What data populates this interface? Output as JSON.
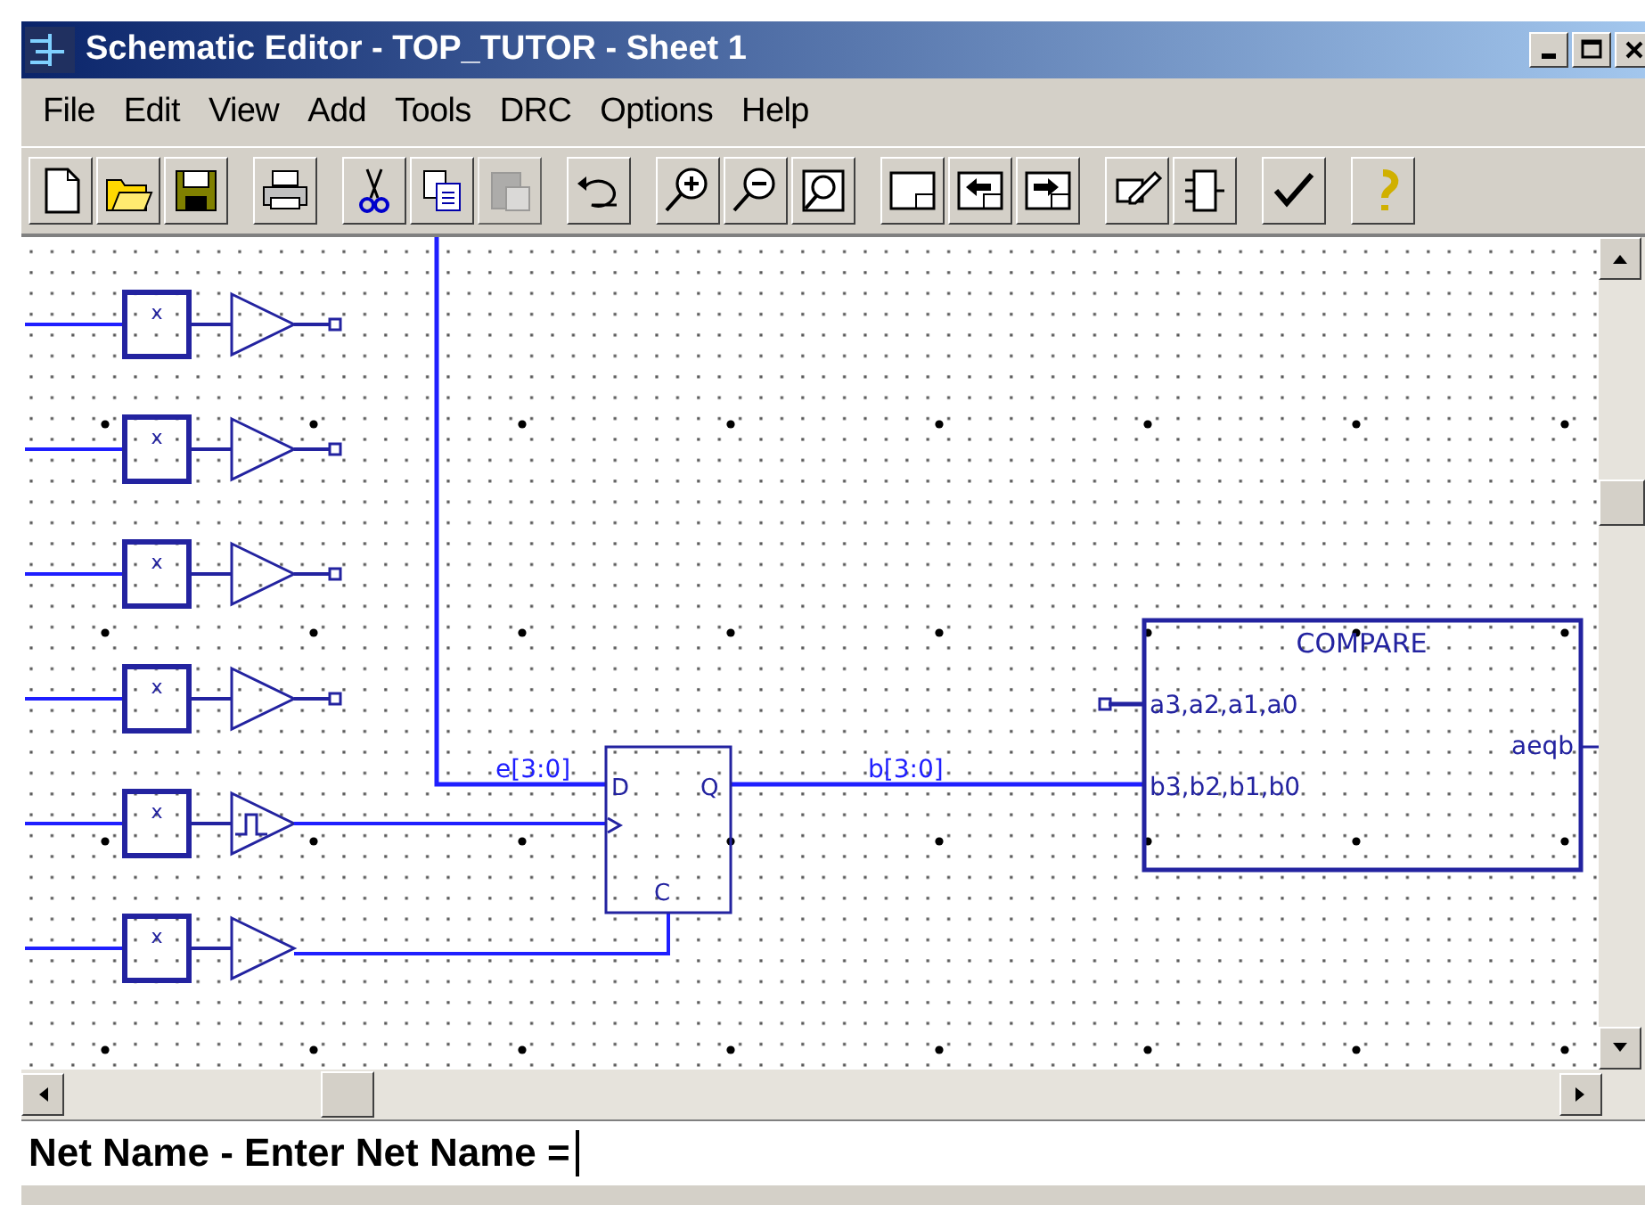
{
  "window": {
    "title": "Schematic Editor - TOP_TUTOR - Sheet 1"
  },
  "menu": [
    "File",
    "Edit",
    "View",
    "Add",
    "Tools",
    "DRC",
    "Options",
    "Help"
  ],
  "toolbar": [
    [
      {
        "kind": "new",
        "disabled": false
      },
      {
        "kind": "open",
        "disabled": false
      },
      {
        "kind": "save",
        "disabled": false
      }
    ],
    [
      {
        "kind": "print",
        "disabled": false
      }
    ],
    [
      {
        "kind": "cut",
        "disabled": false
      },
      {
        "kind": "copy",
        "disabled": false
      },
      {
        "kind": "paste",
        "disabled": true
      }
    ],
    [
      {
        "kind": "undo",
        "disabled": false
      }
    ],
    [
      {
        "kind": "zoom-in",
        "disabled": false
      },
      {
        "kind": "zoom-out",
        "disabled": false
      },
      {
        "kind": "zoom-fit",
        "disabled": false
      }
    ],
    [
      {
        "kind": "sheet",
        "disabled": false
      },
      {
        "kind": "sheet-prev",
        "disabled": false
      },
      {
        "kind": "sheet-next",
        "disabled": false
      }
    ],
    [
      {
        "kind": "edit-symbol",
        "disabled": false
      },
      {
        "kind": "symbol",
        "disabled": false
      }
    ],
    [
      {
        "kind": "check",
        "disabled": false
      }
    ],
    [
      {
        "kind": "help",
        "disabled": false
      }
    ]
  ],
  "schematic": {
    "gates": [
      {
        "kind": "buffer-port",
        "label": "x"
      },
      {
        "kind": "buffer-port",
        "label": "x"
      },
      {
        "kind": "buffer-port",
        "label": "x"
      },
      {
        "kind": "buffer-port",
        "label": "x"
      },
      {
        "kind": "schmitt",
        "label": "x"
      },
      {
        "kind": "buffer",
        "label": "x"
      }
    ],
    "flip_flop": {
      "d": "D",
      "q": "Q",
      "c": "C"
    },
    "nets": [
      "e[3:0]",
      "b[3:0]"
    ],
    "compare": {
      "title": "COMPARE",
      "inputs": [
        "a3,a2,a1,a0",
        "b3,b2,b1,b0"
      ],
      "output": "aeqb"
    }
  },
  "command_line": {
    "prompt": "Net Name - Enter Net Name ="
  }
}
